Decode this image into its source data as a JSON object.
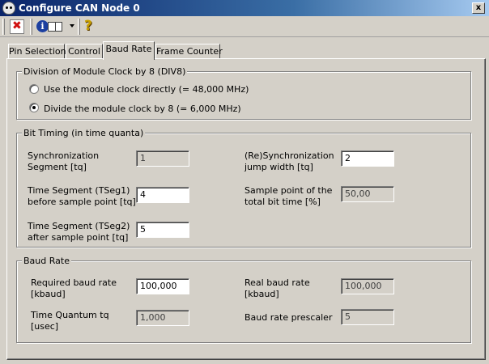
{
  "window": {
    "title": "Configure CAN Node 0",
    "close_label": "x"
  },
  "toolbar": {
    "help_glyph": "?",
    "info_glyph": "i"
  },
  "tabs": [
    {
      "label": "Pin Selection",
      "active": false
    },
    {
      "label": "Control",
      "active": false
    },
    {
      "label": "Baud Rate",
      "active": true
    },
    {
      "label": "Frame Counter",
      "active": false
    }
  ],
  "division": {
    "title": "Division of Module Clock by 8 (DIV8)",
    "options": [
      {
        "label": "Use the module clock directly (= 48,000 MHz)",
        "checked": false
      },
      {
        "label": "Divide the module clock by 8 (= 6,000 MHz)",
        "checked": true
      }
    ]
  },
  "bit_timing": {
    "title": "Bit Timing (in time quanta)",
    "sync_segment": {
      "label_line1": "Synchronization",
      "label_line2": "Segment [tq]",
      "value": "1"
    },
    "tseg1": {
      "label_line1": "Time Segment (TSeg1)",
      "label_line2": "before sample point [tq]",
      "value": "4"
    },
    "tseg2": {
      "label_line1": "Time Segment (TSeg2)",
      "label_line2": "after sample point [tq]",
      "value": "5"
    },
    "sjw": {
      "label_line1": "(Re)Synchronization",
      "label_line2": "jump width [tq]",
      "value": "2"
    },
    "sample_point": {
      "label_line1": "Sample point of the",
      "label_line2": "total bit time [%]",
      "value": "50,00"
    }
  },
  "baud_rate": {
    "title": "Baud Rate",
    "required": {
      "label_line1": "Required baud rate",
      "label_line2": "[kbaud]",
      "value": "100,000"
    },
    "time_quantum": {
      "label_line1": "Time Quantum tq",
      "label_line2": "[usec]",
      "value": "1,000"
    },
    "real": {
      "label_line1": "Real baud rate",
      "label_line2": "[kbaud]",
      "value": "100,000"
    },
    "prescaler": {
      "label": "Baud rate prescaler",
      "value": "5"
    }
  }
}
